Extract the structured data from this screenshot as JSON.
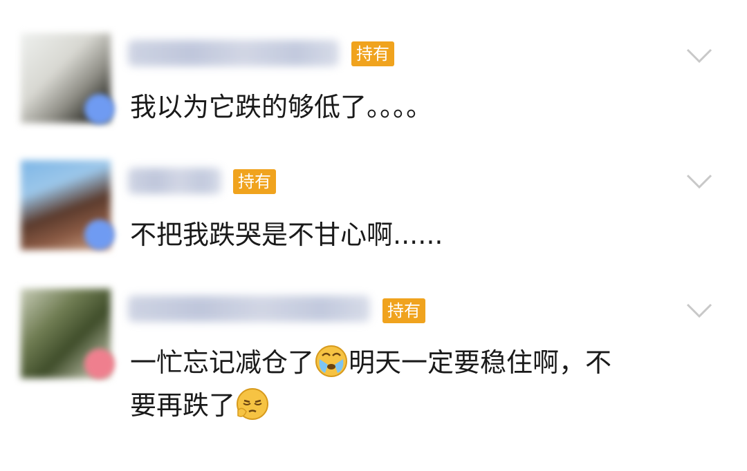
{
  "comments": [
    {
      "avatar_icon": "user-avatar-blurred",
      "badge_color": "#6f9bf2",
      "tag": "持有",
      "text": "我以为它跌的够低了。。。。"
    },
    {
      "avatar_icon": "user-avatar-blurred",
      "badge_color": "#6f9bf2",
      "tag": "持有",
      "text": "不把我跌哭是不甘心啊......"
    },
    {
      "avatar_icon": "user-avatar-blurred",
      "badge_color": "#ef7f8e",
      "tag": "持有",
      "text_part1": "一忙忘记减仓了",
      "emoji1": "crying-face-emoji",
      "text_part2": "明天一定要稳住啊，不",
      "text_line2": "要再跌了",
      "emoji2": "sleepy-face-emoji"
    }
  ],
  "colors": {
    "tag_bg": "#f0a31e",
    "chevron": "#c8c8c8",
    "text": "#1a1a1a"
  }
}
